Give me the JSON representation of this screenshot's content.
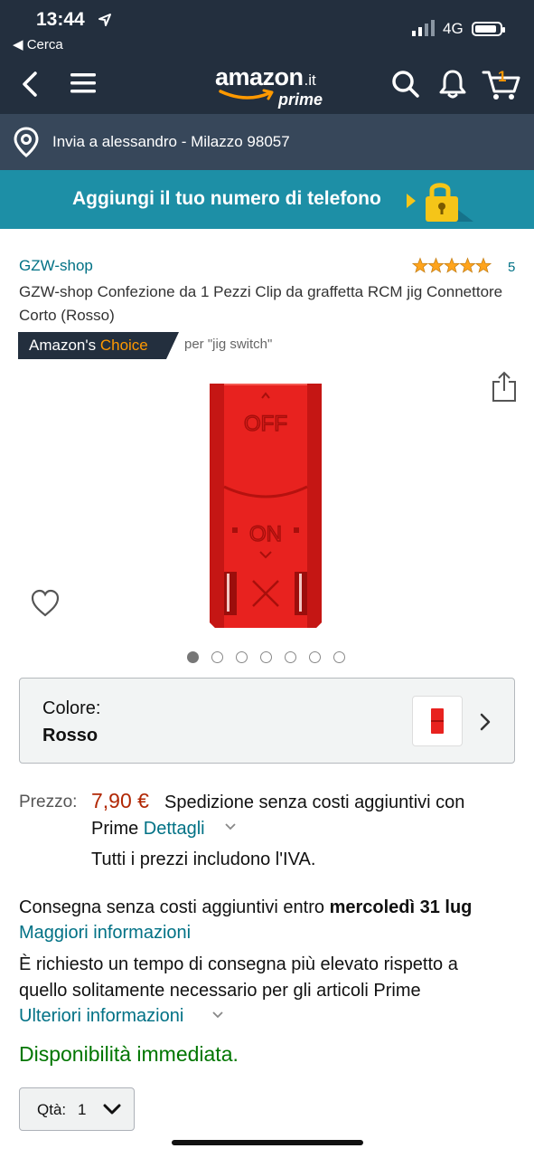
{
  "status": {
    "time": "13:44",
    "back_app": "◀ Cerca",
    "network": "4G",
    "battery_level": 0.9
  },
  "nav": {
    "logo_text": "amazon",
    "logo_tld": ".it",
    "logo_prime": "prime",
    "cart_count": "1"
  },
  "delivery": {
    "text": "Invia a alessandro - Milazzo 98057"
  },
  "banner": {
    "text": "Aggiungi il tuo numero di telefono"
  },
  "product": {
    "brand": "GZW-shop",
    "rating_stars": 5,
    "rating_count": "5",
    "title": "GZW-shop Confezione da 1 Pezzi Clip da graffetta RCM jig Connettore Corto (Rosso)",
    "choice_label_prefix": "Amazon's",
    "choice_label_accent": "Choice",
    "choice_for": "per \"jig switch\"",
    "image_labels": {
      "off": "OFF",
      "on": "ON"
    },
    "image_count": 7,
    "image_active_index": 0
  },
  "color": {
    "label": "Colore:",
    "value": "Rosso"
  },
  "pricing": {
    "label": "Prezzo:",
    "price": "7,90 €",
    "shipping": "Spedizione senza costi aggiuntivi con",
    "prime": "Prime",
    "details": "Dettagli",
    "iva": "Tutti i prezzi includono l'IVA."
  },
  "delivery_info": {
    "text": "Consegna senza costi aggiuntivi entro",
    "date": "mercoledì 31 lug",
    "more": "Maggiori informazioni",
    "note_line1": "È richiesto un tempo di consegna più elevato rispetto a",
    "note_line2": "quello solitamente necessario per gli articoli Prime",
    "more2": "Ulteriori informazioni"
  },
  "availability": "Disponibilità immediata.",
  "quantity": {
    "label": "Qtà:",
    "value": "1"
  },
  "colors": {
    "nav_bg": "#232f3e",
    "sub_bg": "#37475a",
    "banner_bg": "#1d8fa6",
    "link": "#007185",
    "price": "#b12704",
    "accent": "#ff9900",
    "available": "#007600",
    "product_red": "#e8221f"
  }
}
